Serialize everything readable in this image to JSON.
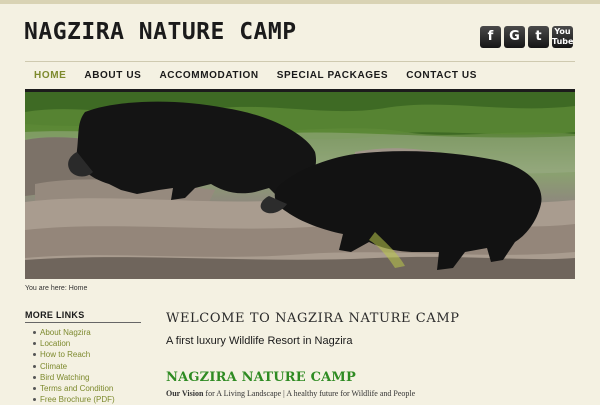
{
  "site": {
    "title": "NAGZIRA NATURE CAMP"
  },
  "social": [
    {
      "icon": "facebook-icon",
      "glyph": "f"
    },
    {
      "icon": "google-plus-icon",
      "glyph": "G"
    },
    {
      "icon": "twitter-icon",
      "glyph": "t"
    },
    {
      "icon": "youtube-icon",
      "glyph": "You\nTube"
    }
  ],
  "nav": {
    "items": [
      {
        "label": "HOME",
        "active": true
      },
      {
        "label": "ABOUT US"
      },
      {
        "label": "ACCOMMODATION"
      },
      {
        "label": "SPECIAL PACKAGES"
      },
      {
        "label": "CONTACT US"
      }
    ]
  },
  "banner": {
    "subject": "sloth-bears-photo"
  },
  "breadcrumb": "You are here: Home",
  "sidebar": {
    "heading": "MORE LINKS",
    "links": [
      "About Nagzira",
      "Location",
      "How to Reach",
      "Climate",
      "Bird Watching",
      "Terms and Condition",
      "Free Brochure (PDF)"
    ]
  },
  "main": {
    "welcome": "WELCOME TO NAGZIRA NATURE CAMP",
    "tagline": "A first luxury Wildlife Resort in Nagzira",
    "camp_title": "NAGZIRA NATURE CAMP",
    "vision_label": "Our Vision",
    "vision_text": " for A Living Landscape | A healthy future for Wildlife and People"
  },
  "colors": {
    "background": "#f4f1e2",
    "accent_green": "#7d8a2e",
    "heading_green": "#2e8b22",
    "text_dark": "#1a1a1a"
  }
}
